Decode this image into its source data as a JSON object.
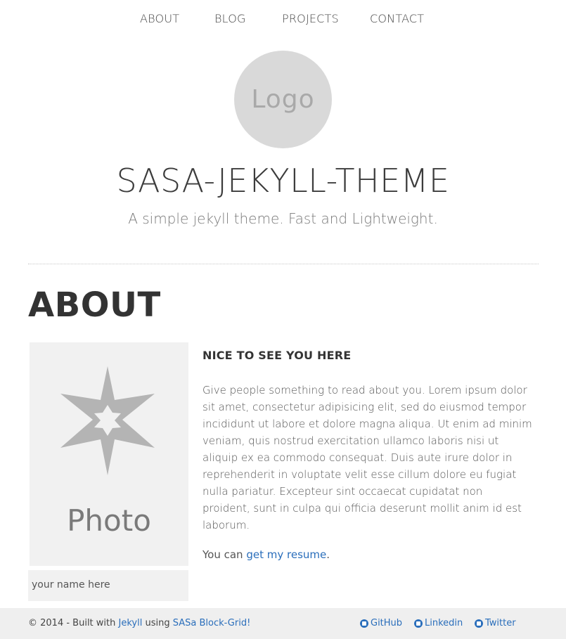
{
  "nav": {
    "items": [
      "ABOUT",
      "BLOG",
      "PROJECTS",
      "CONTACT"
    ]
  },
  "header": {
    "logo_text": "Logo",
    "title": "SASA-JEKYLL-THEME",
    "tagline": "A simple jekyll theme. Fast and Lightweight."
  },
  "main": {
    "heading": "ABOUT",
    "photo_label": "Photo",
    "photo_caption": "your name here",
    "subheading": "NICE TO SEE YOU HERE",
    "body": "Give people something to read about you. Lorem ipsum dolor sit amet, consectetur adipisicing elit, sed do eiusmod tempor incididunt ut labore et dolore magna aliqua. Ut enim ad minim veniam, quis nostrud exercitation ullamco laboris nisi ut aliquip ex ea commodo consequat. Duis aute irure dolor in reprehenderit in voluptate velit esse cillum dolore eu fugiat nulla pariatur. Excepteur sint occaecat cupidatat non proident, sunt in culpa qui officia deserunt mollit anim id est laborum.",
    "resume_prefix": "You can ",
    "resume_link": "get my resume",
    "resume_suffix": "."
  },
  "footer": {
    "copy_prefix": "© 2014 - Built with ",
    "jekyll_link": "Jekyll",
    "copy_middle": " using ",
    "blockgrid_link": "SASa Block-Grid!",
    "social": [
      {
        "label": "GitHub",
        "icon": "github-icon"
      },
      {
        "label": "Linkedin",
        "icon": "linkedin-icon"
      },
      {
        "label": "Twitter",
        "icon": "twitter-icon"
      }
    ]
  },
  "colors": {
    "accent": "#2a6ebb",
    "footer_bg": "#efefef",
    "placeholder_bg": "#f1f1f1",
    "logo_bg": "#d9d9d9"
  }
}
